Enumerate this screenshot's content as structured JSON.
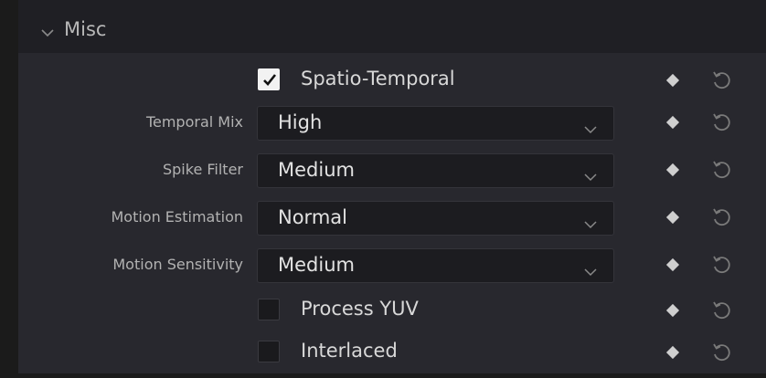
{
  "header": {
    "title": "Misc"
  },
  "rows": [
    {
      "type": "checkbox",
      "label": "Spatio-Temporal",
      "checked": true
    },
    {
      "type": "dropdown",
      "label": "Temporal Mix",
      "value": "High"
    },
    {
      "type": "dropdown",
      "label": "Spike Filter",
      "value": "Medium"
    },
    {
      "type": "dropdown",
      "label": "Motion Estimation",
      "value": "Normal"
    },
    {
      "type": "dropdown",
      "label": "Motion Sensitivity",
      "value": "Medium"
    },
    {
      "type": "checkbox",
      "label": "Process YUV",
      "checked": false
    },
    {
      "type": "checkbox",
      "label": "Interlaced",
      "checked": false
    }
  ],
  "icons": {
    "section_toggle": "chevron-down-icon",
    "dropdown_arrow": "chevron-down-icon",
    "checkbox_mark": "checkmark-icon",
    "keyframe": "keyframe-diamond-icon",
    "reset": "reset-icon"
  }
}
